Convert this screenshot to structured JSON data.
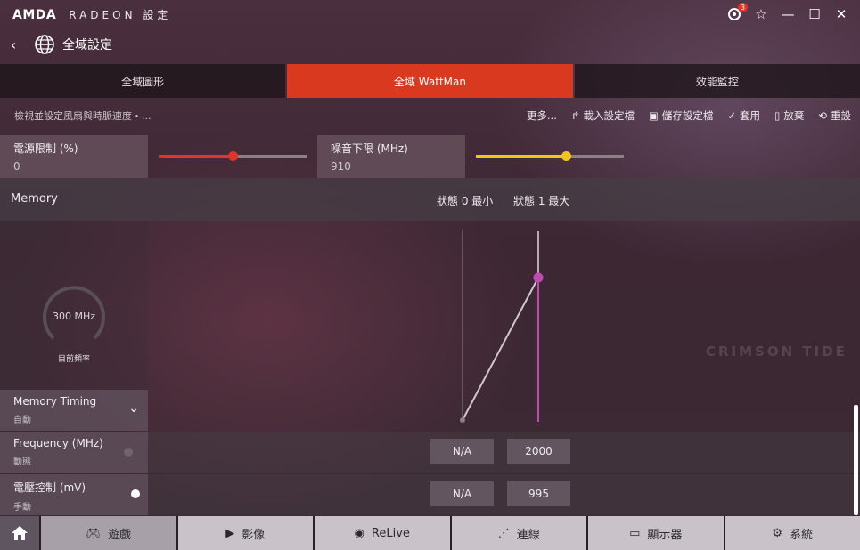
{
  "window": {
    "brand_amd": "AMDA",
    "brand_radeon": "RADEON 設定",
    "notification_count": "3"
  },
  "header": {
    "title": "全域設定"
  },
  "tabs": [
    {
      "label": "全域圖形"
    },
    {
      "label": "全域 WattMan"
    },
    {
      "label": "效能監控"
    }
  ],
  "toolbar": {
    "description": "檢視並設定風扇與時脈速度・...",
    "more": "更多...",
    "load_profile": "載入設定檔",
    "save_profile": "儲存設定檔",
    "apply": "套用",
    "discard": "放棄",
    "reset": "重設"
  },
  "power_limit": {
    "label": "電源限制 (%)",
    "value": "0",
    "slider_fraction": 0.5
  },
  "noise_floor": {
    "label": "噪音下限 (MHz)",
    "value": "910",
    "slider_fraction": 0.6
  },
  "memory": {
    "label": "Memory",
    "state0": "狀態 0 最小",
    "state1": "狀態 1 最大",
    "gauge_value": "300 MHz",
    "gauge_caption": "目前頻率"
  },
  "watermark": "CRIMSON TIDE",
  "memory_timing": {
    "label": "Memory Timing",
    "value": "自動"
  },
  "frequency": {
    "label": "Frequency (MHz)",
    "mode": "動態",
    "state0": "N/A",
    "state1": "2000"
  },
  "voltage": {
    "label": "電壓控制 (mV)",
    "mode": "手動",
    "state0": "N/A",
    "state1": "995"
  },
  "bottom_nav": {
    "games": "遊戲",
    "video": "影像",
    "relive": "ReLive",
    "connect": "連線",
    "display": "顯示器",
    "system": "系統"
  },
  "colors": {
    "accent": "#d9391f",
    "power_slider": "#e0352b",
    "noise_slider": "#f2c51b",
    "curve_magenta": "#c04ab0"
  }
}
